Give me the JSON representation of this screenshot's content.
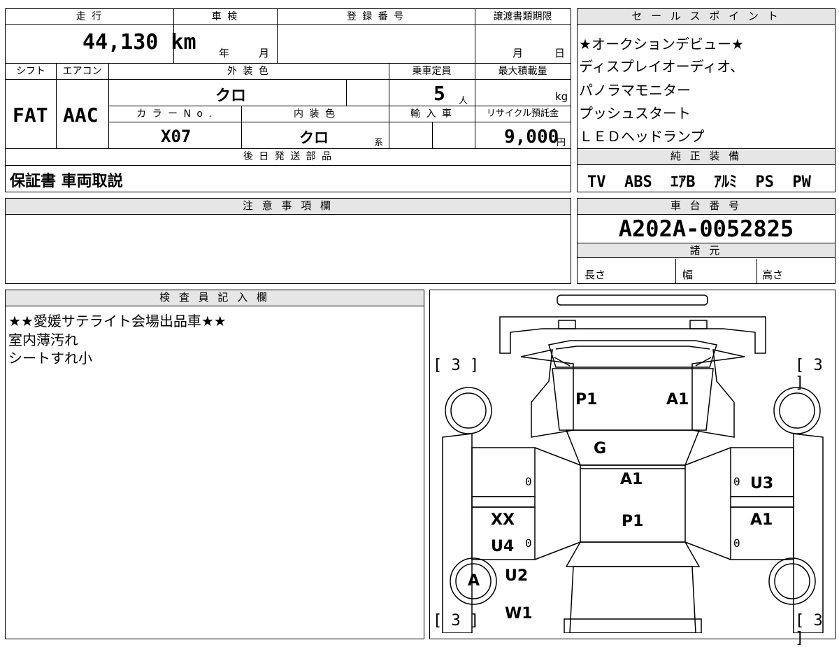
{
  "top": {
    "sokou_label": "走 行",
    "sokou_value": "44,130 km",
    "shaken_label": "車 検",
    "shaken_year": "年",
    "shaken_month": "月",
    "toroku_label": "登 録 番 号",
    "joto_label": "譲渡書類期限",
    "joto_month": "月",
    "joto_day": "日",
    "shift_label": "シフト",
    "shift_value": "FAT",
    "aircon_label": "エアコン",
    "aircon_value": "AAC",
    "gaisou_label": "外 装 色",
    "gaisou_value": "クロ",
    "teiin_label": "乗車定員",
    "teiin_value": "5",
    "teiin_unit": "人",
    "max_label": "最大積載量",
    "max_unit": "kg",
    "color_no_label": "カ ラ ー N o .",
    "color_no_value": "X07",
    "naisou_label": "内 装 色",
    "naisou_value": "クロ",
    "naisou_unit": "系",
    "yunyu_label": "輸 入 車",
    "recycle_label": "リサイクル預託金",
    "recycle_value": "9,000",
    "recycle_unit": "円",
    "gojitsu_label": "後 日 発 送 部 品",
    "gojitsu_value": "保証書 車両取説"
  },
  "sales": {
    "label": "セ ー ル ス ポ イ ン ト",
    "lines": [
      "★オークションデビュー★",
      "ディスプレイオーディオ、",
      "パノラマモニター",
      "プッシュスタート",
      "ＬＥＤヘッドランプ"
    ]
  },
  "equipment": {
    "label": "純 正 装 備",
    "value": "TV  ABS  ｴｱB  ｱﾙﾐ  PS  PW"
  },
  "notes": {
    "label": "注 意 事 項 欄"
  },
  "chassis": {
    "label": "車 台 番 号",
    "value": "A202A-0052825",
    "spec_label": "諸 元",
    "length": "長さ",
    "width": "幅",
    "height": "高さ"
  },
  "inspector": {
    "label": "検 査 員 記 入 欄",
    "lines": [
      "★★愛媛サテライト会場出品車★★",
      "室内薄汚れ",
      "シートすれ小"
    ]
  },
  "diagram": {
    "tire_grades": [
      "[ 3 ]",
      "[ 3 ]",
      "[ 3 ]",
      "[ 3 ]"
    ],
    "codes": {
      "hood_left": "P1",
      "hood_right": "A1",
      "windshield": "G",
      "roof_top": "A1",
      "roof_bottom": "P1",
      "right_front": "U3",
      "right_rear": "A1",
      "left_rear_1": "XX",
      "left_rear_2": "U4",
      "left_rear_3": "U2",
      "left_rear_4": "W1",
      "left_wheel": "A"
    },
    "zeros": [
      "0",
      "0",
      "0",
      "0"
    ]
  }
}
